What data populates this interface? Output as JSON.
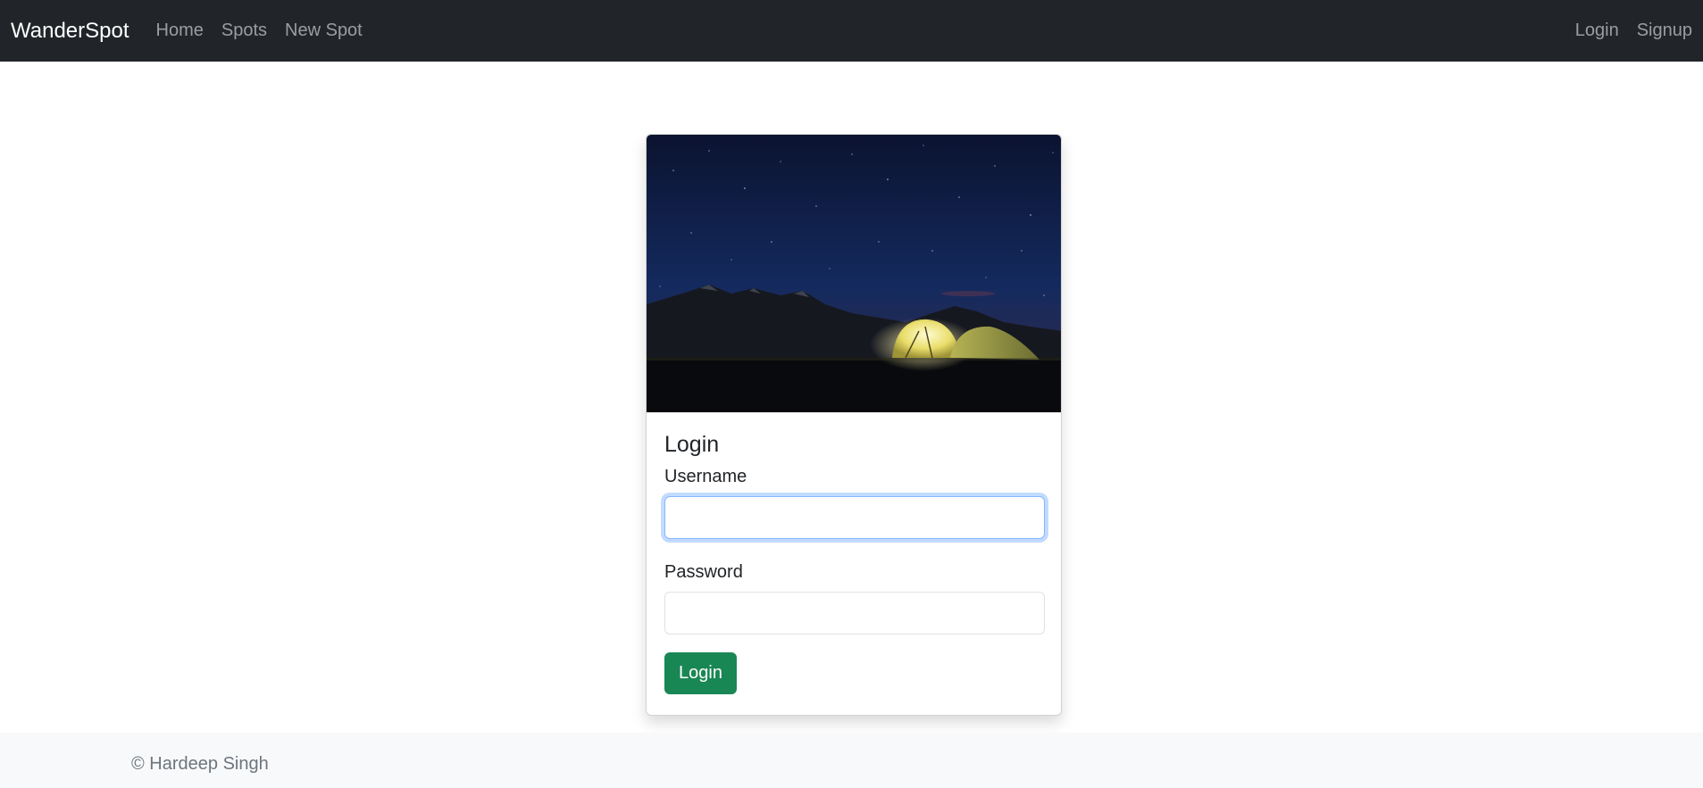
{
  "navbar": {
    "brand": "WanderSpot",
    "links": [
      {
        "label": "Home"
      },
      {
        "label": "Spots"
      },
      {
        "label": "New Spot"
      }
    ],
    "right_links": [
      {
        "label": "Login"
      },
      {
        "label": "Signup"
      }
    ]
  },
  "login_card": {
    "image": "night-camping-tent-under-stars",
    "title": "Login",
    "username": {
      "label": "Username",
      "value": "",
      "placeholder": ""
    },
    "password": {
      "label": "Password",
      "value": "",
      "placeholder": ""
    },
    "submit_label": "Login"
  },
  "footer": {
    "text": "© Hardeep Singh"
  },
  "colors": {
    "navbar_bg": "#212529",
    "primary_button": "#198754",
    "footer_bg": "#f8f9fa"
  }
}
